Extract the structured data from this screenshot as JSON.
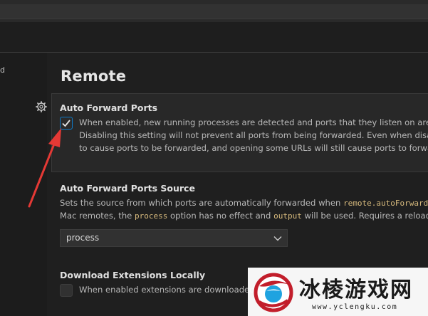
{
  "sidebar": {
    "partial_label": "d"
  },
  "section": {
    "title": "Remote"
  },
  "auto_forward_ports": {
    "title": "Auto Forward Ports",
    "checked": true,
    "desc_line1": "When enabled, new running processes are detected and ports that they listen on are a",
    "desc_line2": "Disabling this setting will not prevent all ports from being forwarded. Even when disab",
    "desc_line3": "to cause ports to be forwarded, and opening some URLs will still cause ports to forwa"
  },
  "auto_forward_ports_source": {
    "title": "Auto Forward Ports Source",
    "desc_line1_pre": "Sets the source from which ports are automatically forwarded when ",
    "desc_line1_code": "remote.autoForward",
    "desc_line2_pre": "Mac remotes, the ",
    "desc_line2_code1": "process",
    "desc_line2_mid": " option has no effect and ",
    "desc_line2_code2": "output",
    "desc_line2_post": " will be used. Requires a reload",
    "selected": "process"
  },
  "download_extensions_locally": {
    "title": "Download Extensions Locally",
    "checked": false,
    "desc": "When enabled extensions are downloaded"
  },
  "watermark": {
    "text": "冰棱游戏网",
    "url": "www.yclengku.com"
  },
  "colors": {
    "accent": "#0e7ac7",
    "arrow": "#e53935",
    "code": "#d7ba7d"
  }
}
